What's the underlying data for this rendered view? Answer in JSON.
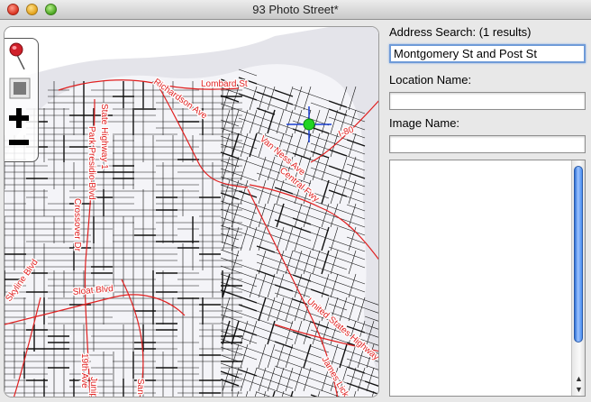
{
  "window": {
    "title": "93 Photo Street*"
  },
  "toolbar": {
    "tools": [
      {
        "name": "pin",
        "icon": "pushpin-icon"
      },
      {
        "name": "select",
        "icon": "selection-frame-icon"
      },
      {
        "name": "zoom-in",
        "icon": "plus-icon"
      },
      {
        "name": "zoom-out",
        "icon": "minus-icon"
      }
    ]
  },
  "map": {
    "road_color": "#111111",
    "highway_color": "#e02020",
    "street_labels": [
      "Lombard St",
      "Richardson Ave",
      "State Highway 1",
      "Park Presidio Blvd",
      "Crossover Dr",
      "Sloat Blvd",
      "Skyline Blvd",
      "Van Ness Ave",
      "Central Fwy",
      "I-80",
      "United States Highway",
      "James Lick",
      "19th Ave",
      "Junipe",
      "San"
    ],
    "marker_color": "#22d422"
  },
  "form": {
    "address_label": "Address Search: (1 results)",
    "address_value": "Montgomery St and Post St",
    "location_label": "Location Name:",
    "location_value": "",
    "image_label": "Image Name:",
    "image_value": "",
    "notes_value": ""
  }
}
